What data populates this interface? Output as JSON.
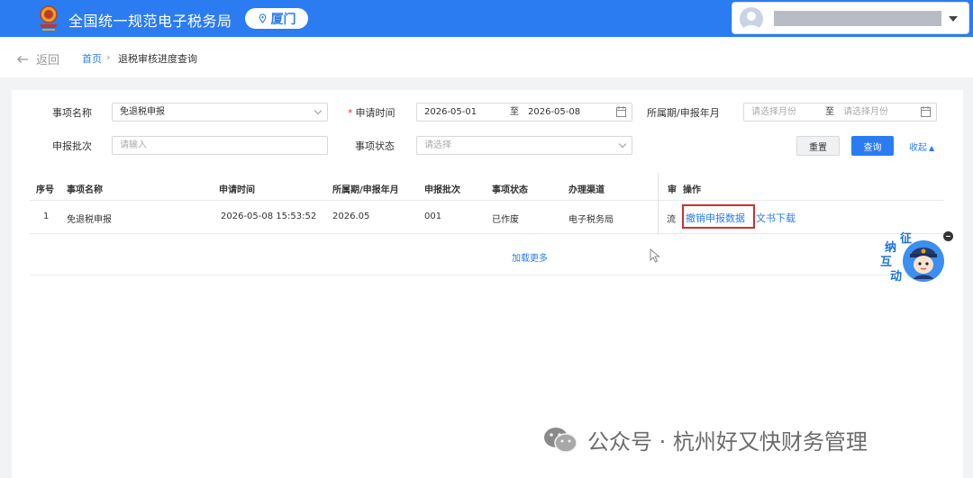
{
  "header": {
    "site_title": "全国统一规范电子税务局",
    "region": "厦门"
  },
  "breadcrumb": {
    "back_label": "返回",
    "home": "首页",
    "separator": "›",
    "current": "退税审核进度查询"
  },
  "filters": {
    "item_name_label": "事项名称",
    "item_name_value": "免退税申报",
    "apply_time_required": "*",
    "apply_time_label": "申请时间",
    "apply_time_start": "2026-05-01",
    "range_to": "至",
    "apply_time_end": "2026-05-08",
    "period_label": "所属期/申报年月",
    "period_start_placeholder": "请选择月份",
    "period_end_placeholder": "请选择月份",
    "batch_label": "申报批次",
    "batch_placeholder": "请输入",
    "status_label": "事项状态",
    "status_placeholder": "请选择",
    "reset_button": "重置",
    "query_button": "查询",
    "collapse_link": "收起"
  },
  "table": {
    "columns": [
      "序号",
      "事项名称",
      "申请时间",
      "所属期/申报年月",
      "申报批次",
      "事项状态",
      "办理渠道",
      "审",
      "操作"
    ],
    "rows": [
      {
        "index": "1",
        "item_name": "免退税申报",
        "apply_time": "2026-05-08 15:53:52",
        "period": "2026.05",
        "batch": "001",
        "status": "已作废",
        "channel": "电子税务局",
        "audit_truncated": "流",
        "action_revoke": "撤销申报数据",
        "action_download": "文书下载"
      }
    ],
    "load_more": "加载更多"
  },
  "float_widget": {
    "chars": [
      "征",
      "纳",
      "互",
      "动"
    ]
  },
  "watermark": {
    "text": "公众号 · 杭州好又快财务管理"
  },
  "colors": {
    "primary": "#2b7cf0",
    "highlight_border": "#c8312f",
    "header_bg": "#2b7cf0"
  }
}
